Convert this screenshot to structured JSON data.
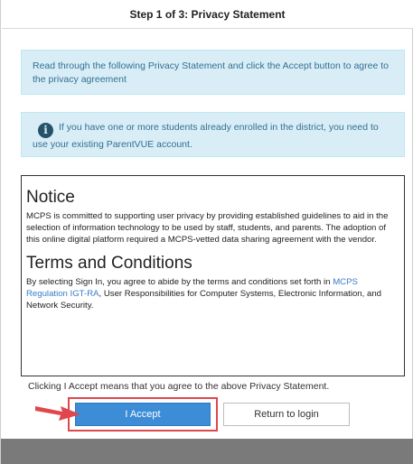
{
  "header": {
    "title": "Step 1 of 3: Privacy Statement"
  },
  "info1": {
    "text": "Read through the following Privacy Statement and click the Accept button to agree to the privacy agreement"
  },
  "info2": {
    "icon": "info-icon",
    "icon_glyph": "i",
    "text": "If you have one or more students already enrolled in the district, you need to use your existing ParentVUE account."
  },
  "notice": {
    "heading": "Notice",
    "body": "MCPS is committed to supporting user privacy by providing established guidelines to aid in the selection of information technology to be used by staff, students, and parents. The adoption of this online digital platform required a MCPS-vetted data sharing agreement with the vendor."
  },
  "terms": {
    "heading": "Terms and Conditions",
    "body_before": "By selecting Sign In, you agree to abide by the terms and conditions set forth in ",
    "link": "MCPS Regulation IGT-RA",
    "body_after": ", User Responsibilities for Computer Systems, Electronic Information, and Network Security."
  },
  "accept_note": "Clicking I Accept means that you agree to the above Privacy Statement.",
  "buttons": {
    "accept": "I Accept",
    "return": "Return to login"
  },
  "colors": {
    "info_bg": "#d9edf7",
    "accent": "#3d8cd6",
    "highlight": "#e0474c",
    "link": "#3a7bc8"
  }
}
